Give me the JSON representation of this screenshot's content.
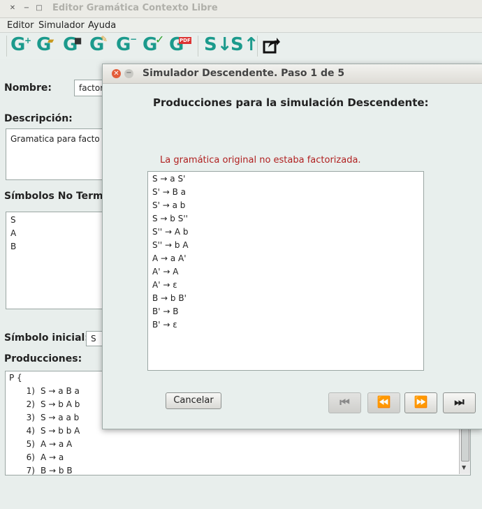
{
  "window": {
    "title": "Editor Gramática Contexto Libre"
  },
  "menu": [
    "Editor",
    "Simulador",
    "Ayuda"
  ],
  "toolbar": {
    "icons": [
      "new-grammar-icon",
      "open-grammar-icon",
      "save-grammar-icon",
      "edit-grammar-icon",
      "remove-grammar-icon",
      "validate-grammar-icon",
      "export-pdf-icon",
      "simulate-descending-icon",
      "simulate-ascending-icon",
      "export-icon"
    ]
  },
  "form": {
    "name_label": "Nombre:",
    "name_value": "factor",
    "description_label": "Descripción:",
    "description_value": "Gramatica para facto",
    "nonterminals_label": "Símbolos No Termin",
    "nonterminals": [
      "S",
      "A",
      "B"
    ],
    "initial_label": "Símbolo inicial:",
    "initial_value": "S",
    "productions_label": "Producciones:",
    "productions_header": "P {",
    "productions": [
      {
        "num": "1)",
        "text": "S → a B a"
      },
      {
        "num": "2)",
        "text": "S → b A b"
      },
      {
        "num": "3)",
        "text": "S → a a b"
      },
      {
        "num": "4)",
        "text": "S → b b A"
      },
      {
        "num": "5)",
        "text": "A → a A"
      },
      {
        "num": "6)",
        "text": "A → a"
      },
      {
        "num": "7)",
        "text": "B → b B"
      }
    ]
  },
  "dialog": {
    "title": "Simulador Descendente. Paso 1 de 5",
    "heading": "Producciones para la simulación Descendente:",
    "warning": "La gramática original no estaba factorizada.",
    "productions": [
      "S → a S'",
      "S' → B a",
      "S' → a b",
      "S → b S''",
      "S'' → A b",
      "S'' → b A",
      "A → a A'",
      "A' → A",
      "A' → ε",
      "B → b B'",
      "B' → B",
      "B' → ε"
    ],
    "cancel_label": "Cancelar",
    "nav": {
      "first": "⏮",
      "prev": "⏪",
      "next": "⏩",
      "last": "⏭"
    }
  },
  "colors": {
    "accent": "#1b9a8c",
    "warning": "#b02020",
    "close": "#e35d3a"
  }
}
